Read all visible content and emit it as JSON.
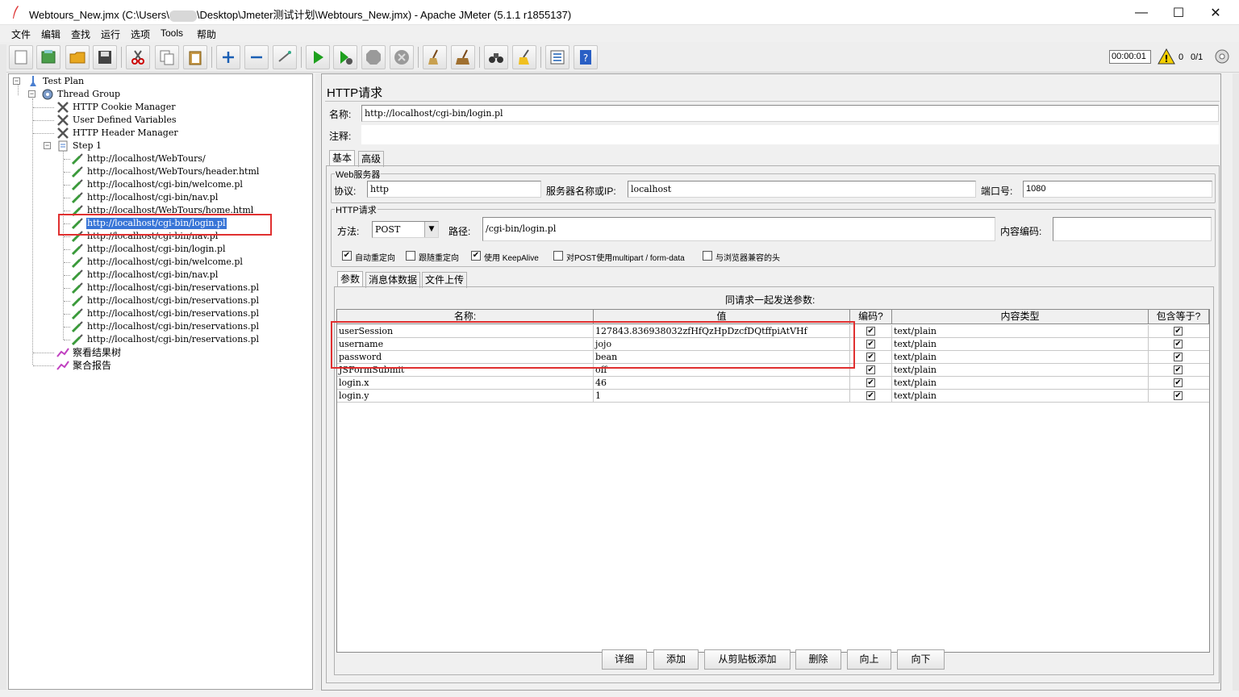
{
  "window": {
    "title_prefix": "Webtours_New.jmx (C:\\Users\\",
    "title_suffix": "\\Desktop\\Jmeter测试计划\\Webtours_New.jmx) - Apache JMeter (5.1.1 r1855137)",
    "minimize": "—",
    "maximize": "☐",
    "close": "✕"
  },
  "menu": [
    "文件",
    "编辑",
    "查找",
    "运行",
    "选项",
    "Tools",
    "帮助"
  ],
  "status": {
    "timer": "00:00:01",
    "warnings": "0",
    "threads": "0/1"
  },
  "tree": {
    "test_plan": "Test Plan",
    "thread_group": "Thread Group",
    "config": [
      "HTTP Cookie Manager",
      "User Defined Variables",
      "HTTP Header Manager"
    ],
    "step": "Step 1",
    "samplers": [
      "http://localhost/WebTours/",
      "http://localhost/WebTours/header.html",
      "http://localhost/cgi-bin/welcome.pl",
      "http://localhost/cgi-bin/nav.pl",
      "http://localhost/WebTours/home.html",
      "http://localhost/cgi-bin/login.pl",
      "http://localhost/cgi-bin/nav.pl",
      "http://localhost/cgi-bin/login.pl",
      "http://localhost/cgi-bin/welcome.pl",
      "http://localhost/cgi-bin/nav.pl",
      "http://localhost/cgi-bin/reservations.pl",
      "http://localhost/cgi-bin/reservations.pl",
      "http://localhost/cgi-bin/reservations.pl",
      "http://localhost/cgi-bin/reservations.pl",
      "http://localhost/cgi-bin/reservations.pl"
    ],
    "selected_index": 5,
    "listeners": [
      "察看结果树",
      "聚合报告"
    ]
  },
  "panel": {
    "heading": "HTTP请求",
    "name_label": "名称:",
    "name_value": "http://localhost/cgi-bin/login.pl",
    "comment_label": "注释:",
    "tabs": [
      "基本",
      "高级"
    ],
    "web_server_title": "Web服务器",
    "protocol_label": "协议:",
    "protocol_value": "http",
    "server_label": "服务器名称或IP:",
    "server_value": "localhost",
    "port_label": "端口号:",
    "port_value": "1080",
    "http_request_title": "HTTP请求",
    "method_label": "方法:",
    "method_value": "POST",
    "path_label": "路径:",
    "path_value": "/cgi-bin/login.pl",
    "encoding_label": "内容编码:",
    "checkboxes": [
      {
        "label": "自动重定向",
        "checked": true
      },
      {
        "label": "跟随重定向",
        "checked": false
      },
      {
        "label": "使用 KeepAlive",
        "checked": true
      },
      {
        "label": "对POST使用multipart / form-data",
        "checked": false
      },
      {
        "label": "与浏览器兼容的头",
        "checked": false
      }
    ],
    "subtabs": [
      "参数",
      "消息体数据",
      "文件上传"
    ],
    "params_caption": "同请求一起发送参数:",
    "columns": [
      "名称:",
      "值",
      "编码?",
      "内容类型",
      "包含等于?"
    ],
    "rows": [
      {
        "name": "userSession",
        "value": "127843.836938032zfHfQzHpDzcfDQtffpiAtVHf",
        "encode": true,
        "type": "text/plain",
        "include_equals": true
      },
      {
        "name": "username",
        "value": "jojo",
        "encode": true,
        "type": "text/plain",
        "include_equals": true
      },
      {
        "name": "password",
        "value": "bean",
        "encode": true,
        "type": "text/plain",
        "include_equals": true
      },
      {
        "name": "JSFormSubmit",
        "value": "off",
        "encode": true,
        "type": "text/plain",
        "include_equals": true
      },
      {
        "name": "login.x",
        "value": "46",
        "encode": true,
        "type": "text/plain",
        "include_equals": true
      },
      {
        "name": "login.y",
        "value": "1",
        "encode": true,
        "type": "text/plain",
        "include_equals": true
      }
    ],
    "buttons": [
      "详细",
      "添加",
      "从剪贴板添加",
      "删除",
      "向上",
      "向下"
    ]
  }
}
